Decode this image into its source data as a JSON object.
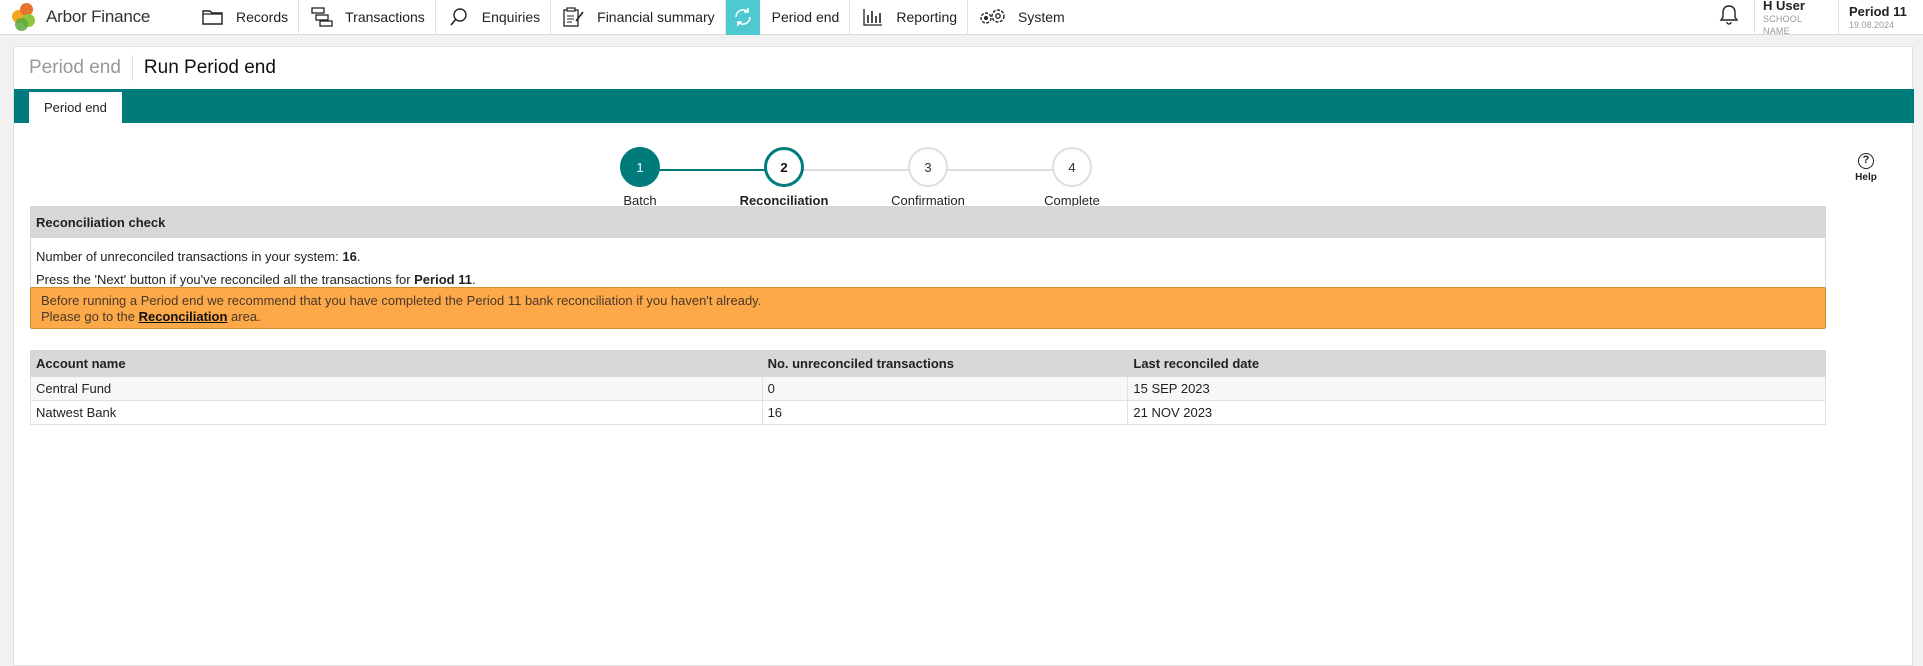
{
  "brand": {
    "name": "Arbor Finance"
  },
  "nav": [
    {
      "label": "Records",
      "icon": "folder-icon"
    },
    {
      "label": "Transactions",
      "icon": "transactions-icon"
    },
    {
      "label": "Enquiries",
      "icon": "search-icon"
    },
    {
      "label": "Financial summary",
      "icon": "clipboard-icon"
    },
    {
      "label": "Period end",
      "icon": "refresh-icon",
      "active": true
    },
    {
      "label": "Reporting",
      "icon": "bar-chart-icon"
    },
    {
      "label": "System",
      "icon": "settings-icon"
    }
  ],
  "user": {
    "name": "H User",
    "school": "SCHOOL NAME"
  },
  "period": {
    "name": "Period 11",
    "date": "19.08.2024"
  },
  "page": {
    "breadcrumb": "Period end",
    "title": "Run Period end"
  },
  "tabs": [
    {
      "label": "Period end"
    }
  ],
  "steps": [
    {
      "number": "1",
      "label": "Batch",
      "state": "done"
    },
    {
      "number": "2",
      "label": "Reconciliation",
      "state": "current"
    },
    {
      "number": "3",
      "label": "Confirmation",
      "state": "pending"
    },
    {
      "number": "4",
      "label": "Complete",
      "state": "pending"
    }
  ],
  "help": {
    "label": "Help",
    "glyph": "?"
  },
  "check": {
    "title": "Reconciliation check",
    "line1_prefix": "Number of unreconciled transactions in your system: ",
    "line1_count": "16",
    "line1_suffix": ".",
    "line2_prefix": "Press the 'Next' button if you've reconciled all the transactions for ",
    "line2_period": "Period 11",
    "line2_suffix": "."
  },
  "alert": {
    "line1": "Before running a Period end we recommend that you have completed the Period 11 bank reconciliation if you haven't already.",
    "line2_prefix": "Please go to the ",
    "link": "Reconciliation",
    "line2_suffix": " area."
  },
  "table": {
    "headers": [
      "Account name",
      "No. unreconciled transactions",
      "Last reconciled date"
    ],
    "rows": [
      [
        "Central Fund",
        "0",
        "15 SEP 2023"
      ],
      [
        "Natwest Bank",
        "16",
        "21 NOV 2023"
      ]
    ]
  },
  "colors": {
    "accent": "#007b7c",
    "active_nav": "#4fc9d1",
    "warning": "#fda849"
  }
}
